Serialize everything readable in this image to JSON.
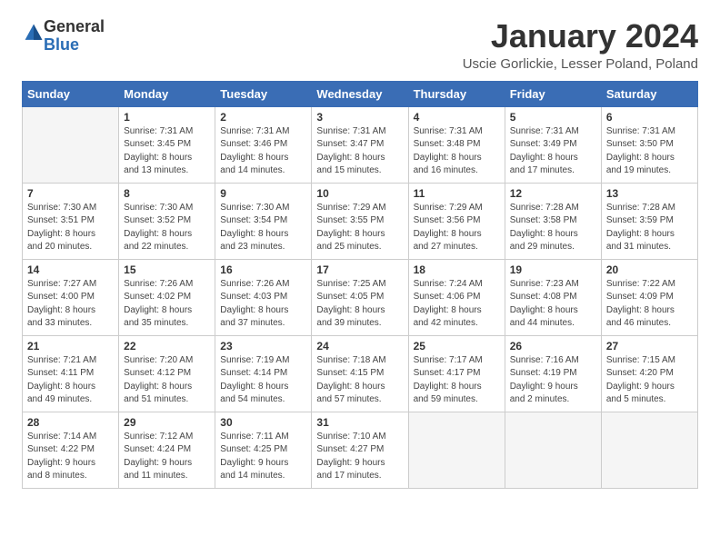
{
  "logo": {
    "general": "General",
    "blue": "Blue"
  },
  "header": {
    "title": "January 2024",
    "subtitle": "Uscie Gorlickie, Lesser Poland, Poland"
  },
  "weekdays": [
    "Sunday",
    "Monday",
    "Tuesday",
    "Wednesday",
    "Thursday",
    "Friday",
    "Saturday"
  ],
  "weeks": [
    [
      {
        "num": "",
        "info": ""
      },
      {
        "num": "1",
        "info": "Sunrise: 7:31 AM\nSunset: 3:45 PM\nDaylight: 8 hours\nand 13 minutes."
      },
      {
        "num": "2",
        "info": "Sunrise: 7:31 AM\nSunset: 3:46 PM\nDaylight: 8 hours\nand 14 minutes."
      },
      {
        "num": "3",
        "info": "Sunrise: 7:31 AM\nSunset: 3:47 PM\nDaylight: 8 hours\nand 15 minutes."
      },
      {
        "num": "4",
        "info": "Sunrise: 7:31 AM\nSunset: 3:48 PM\nDaylight: 8 hours\nand 16 minutes."
      },
      {
        "num": "5",
        "info": "Sunrise: 7:31 AM\nSunset: 3:49 PM\nDaylight: 8 hours\nand 17 minutes."
      },
      {
        "num": "6",
        "info": "Sunrise: 7:31 AM\nSunset: 3:50 PM\nDaylight: 8 hours\nand 19 minutes."
      }
    ],
    [
      {
        "num": "7",
        "info": "Sunrise: 7:30 AM\nSunset: 3:51 PM\nDaylight: 8 hours\nand 20 minutes."
      },
      {
        "num": "8",
        "info": "Sunrise: 7:30 AM\nSunset: 3:52 PM\nDaylight: 8 hours\nand 22 minutes."
      },
      {
        "num": "9",
        "info": "Sunrise: 7:30 AM\nSunset: 3:54 PM\nDaylight: 8 hours\nand 23 minutes."
      },
      {
        "num": "10",
        "info": "Sunrise: 7:29 AM\nSunset: 3:55 PM\nDaylight: 8 hours\nand 25 minutes."
      },
      {
        "num": "11",
        "info": "Sunrise: 7:29 AM\nSunset: 3:56 PM\nDaylight: 8 hours\nand 27 minutes."
      },
      {
        "num": "12",
        "info": "Sunrise: 7:28 AM\nSunset: 3:58 PM\nDaylight: 8 hours\nand 29 minutes."
      },
      {
        "num": "13",
        "info": "Sunrise: 7:28 AM\nSunset: 3:59 PM\nDaylight: 8 hours\nand 31 minutes."
      }
    ],
    [
      {
        "num": "14",
        "info": "Sunrise: 7:27 AM\nSunset: 4:00 PM\nDaylight: 8 hours\nand 33 minutes."
      },
      {
        "num": "15",
        "info": "Sunrise: 7:26 AM\nSunset: 4:02 PM\nDaylight: 8 hours\nand 35 minutes."
      },
      {
        "num": "16",
        "info": "Sunrise: 7:26 AM\nSunset: 4:03 PM\nDaylight: 8 hours\nand 37 minutes."
      },
      {
        "num": "17",
        "info": "Sunrise: 7:25 AM\nSunset: 4:05 PM\nDaylight: 8 hours\nand 39 minutes."
      },
      {
        "num": "18",
        "info": "Sunrise: 7:24 AM\nSunset: 4:06 PM\nDaylight: 8 hours\nand 42 minutes."
      },
      {
        "num": "19",
        "info": "Sunrise: 7:23 AM\nSunset: 4:08 PM\nDaylight: 8 hours\nand 44 minutes."
      },
      {
        "num": "20",
        "info": "Sunrise: 7:22 AM\nSunset: 4:09 PM\nDaylight: 8 hours\nand 46 minutes."
      }
    ],
    [
      {
        "num": "21",
        "info": "Sunrise: 7:21 AM\nSunset: 4:11 PM\nDaylight: 8 hours\nand 49 minutes."
      },
      {
        "num": "22",
        "info": "Sunrise: 7:20 AM\nSunset: 4:12 PM\nDaylight: 8 hours\nand 51 minutes."
      },
      {
        "num": "23",
        "info": "Sunrise: 7:19 AM\nSunset: 4:14 PM\nDaylight: 8 hours\nand 54 minutes."
      },
      {
        "num": "24",
        "info": "Sunrise: 7:18 AM\nSunset: 4:15 PM\nDaylight: 8 hours\nand 57 minutes."
      },
      {
        "num": "25",
        "info": "Sunrise: 7:17 AM\nSunset: 4:17 PM\nDaylight: 8 hours\nand 59 minutes."
      },
      {
        "num": "26",
        "info": "Sunrise: 7:16 AM\nSunset: 4:19 PM\nDaylight: 9 hours\nand 2 minutes."
      },
      {
        "num": "27",
        "info": "Sunrise: 7:15 AM\nSunset: 4:20 PM\nDaylight: 9 hours\nand 5 minutes."
      }
    ],
    [
      {
        "num": "28",
        "info": "Sunrise: 7:14 AM\nSunset: 4:22 PM\nDaylight: 9 hours\nand 8 minutes."
      },
      {
        "num": "29",
        "info": "Sunrise: 7:12 AM\nSunset: 4:24 PM\nDaylight: 9 hours\nand 11 minutes."
      },
      {
        "num": "30",
        "info": "Sunrise: 7:11 AM\nSunset: 4:25 PM\nDaylight: 9 hours\nand 14 minutes."
      },
      {
        "num": "31",
        "info": "Sunrise: 7:10 AM\nSunset: 4:27 PM\nDaylight: 9 hours\nand 17 minutes."
      },
      {
        "num": "",
        "info": ""
      },
      {
        "num": "",
        "info": ""
      },
      {
        "num": "",
        "info": ""
      }
    ]
  ]
}
